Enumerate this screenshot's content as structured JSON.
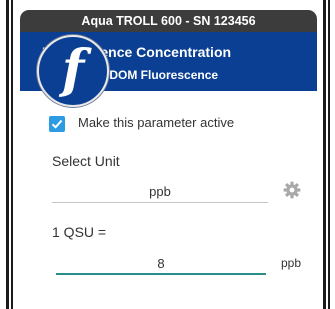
{
  "status_bar": {
    "title": "Aqua TROLL 600 - SN 123456"
  },
  "header": {
    "title": "Fluorescence Concentration",
    "subtitle": "Dissolved FDOM Fluorescence"
  },
  "overlay": {
    "logo": "f"
  },
  "active_checkbox": {
    "checked": true,
    "label": "Make this parameter active"
  },
  "unit_section": {
    "label": "Select Unit",
    "value": "ppb",
    "settings_icon": "gear-icon"
  },
  "qsu_section": {
    "label": "1 QSU =",
    "value": "8",
    "unit": "ppb"
  },
  "colors": {
    "status_bar": "#3c3c3c",
    "header": "#0a3f93",
    "checkbox": "#2c9be3",
    "input_underline": "#2a8f8b"
  }
}
